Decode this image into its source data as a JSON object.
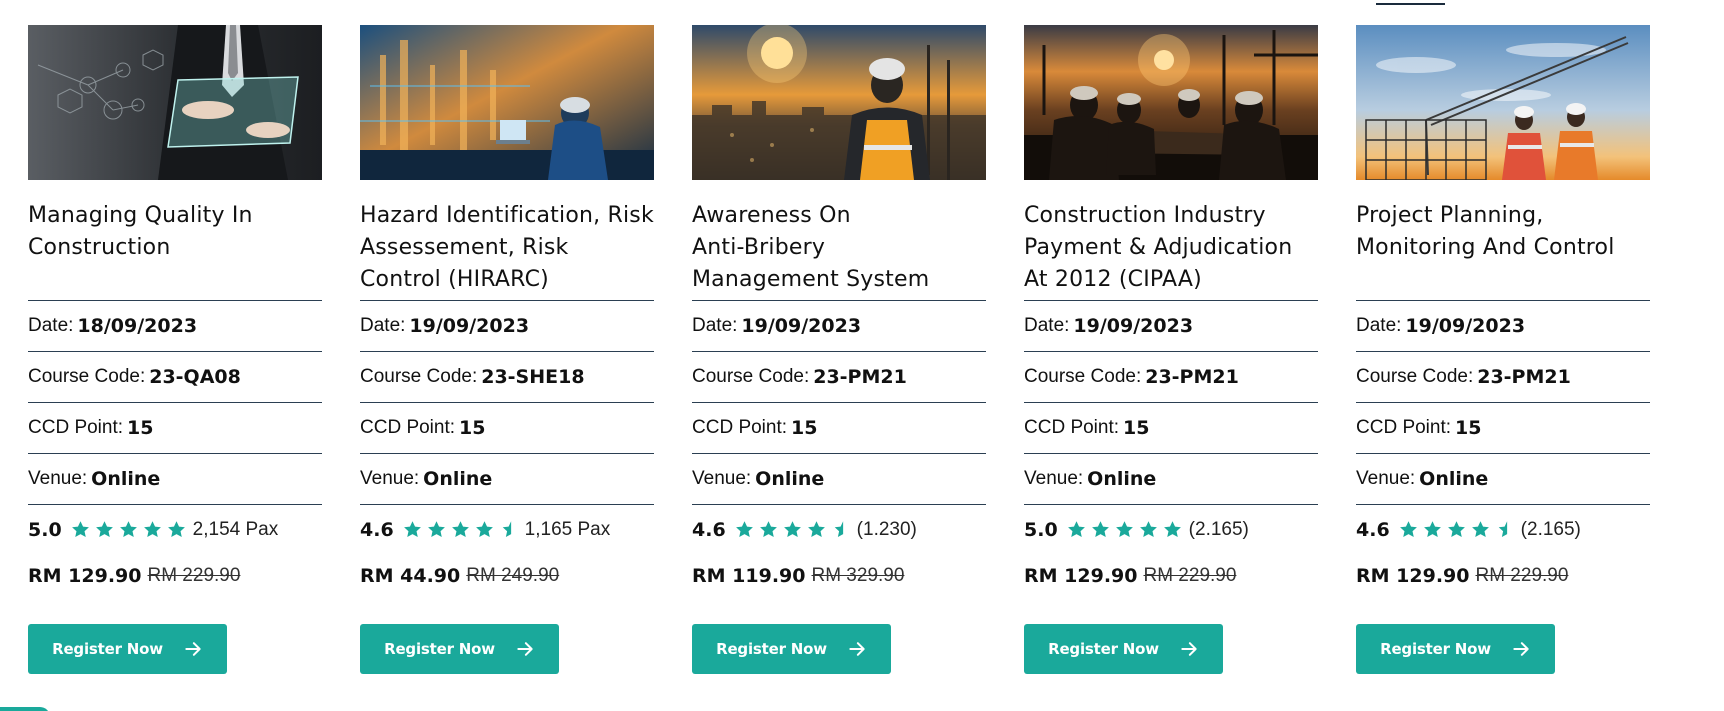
{
  "courses": [
    {
      "title_lines": [
        "Managing Quality In",
        "Construction",
        ""
      ],
      "image": "business-tablet-image",
      "date_label": "Date:",
      "date": "18/09/2023",
      "code_label": "Course Code:",
      "code": "23-QA08",
      "ccd_label": "CCD Point:",
      "ccd": "15",
      "venue_label": "Venue:",
      "venue": "Online",
      "score": "5.0",
      "stars": 5,
      "reviews": "2,154 Pax",
      "price": "RM 129.90",
      "old_price": "RM 229.90",
      "button": "Register Now"
    },
    {
      "title_lines": [
        "Hazard Identification, Risk",
        "Assessement, Risk",
        "Control (HIRARC)"
      ],
      "image": "worker-laptop-image",
      "date_label": "Date:",
      "date": "19/09/2023",
      "code_label": "Course Code:",
      "code": "23-SHE18",
      "ccd_label": "CCD Point:",
      "ccd": "15",
      "venue_label": "Venue:",
      "venue": "Online",
      "score": "4.6",
      "stars": 4.5,
      "reviews": "1,165 Pax",
      "price": "RM 44.90",
      "old_price": "RM 249.90",
      "button": "Register Now"
    },
    {
      "title_lines": [
        "Awareness On",
        "Anti-Bribery",
        "Management System"
      ],
      "image": "worker-sunset-city-image",
      "date_label": "Date:",
      "date": "19/09/2023",
      "code_label": "Course Code:",
      "code": "23-PM21",
      "ccd_label": "CCD Point:",
      "ccd": "15",
      "venue_label": "Venue:",
      "venue": "Online",
      "score": "4.6",
      "stars": 4.5,
      "reviews": "(1.230)",
      "price": "RM 119.90",
      "old_price": "RM 329.90",
      "button": "Register Now"
    },
    {
      "title_lines": [
        "Construction Industry",
        "Payment & Adjudication",
        "At 2012 (CIPAA)"
      ],
      "image": "workers-meeting-sunset-image",
      "date_label": "Date:",
      "date": "19/09/2023",
      "code_label": "Course Code:",
      "code": "23-PM21",
      "ccd_label": "CCD Point:",
      "ccd": "15",
      "venue_label": "Venue:",
      "venue": "Online",
      "score": "5.0",
      "stars": 5,
      "reviews": "(2.165)",
      "price": "RM 129.90",
      "old_price": "RM 229.90",
      "button": "Register Now"
    },
    {
      "title_lines": [
        "Project Planning,",
        "Monitoring And Control",
        ""
      ],
      "image": "crane-construction-site-image",
      "date_label": "Date:",
      "date": "19/09/2023",
      "code_label": "Course Code:",
      "code": "23-PM21",
      "ccd_label": "CCD Point:",
      "ccd": "15",
      "venue_label": "Venue:",
      "venue": "Online",
      "score": "4.6",
      "stars": 4.5,
      "reviews": "(2.165)",
      "price": "RM 129.90",
      "old_price": "RM 229.90",
      "button": "Register Now"
    }
  ],
  "colors": {
    "accent": "#1aa99b",
    "star": "#1aa99b",
    "divider": "#2b3f52"
  },
  "icons": {
    "star": "star-icon",
    "half_star": "half-star-icon",
    "arrow": "arrow-right-icon"
  }
}
